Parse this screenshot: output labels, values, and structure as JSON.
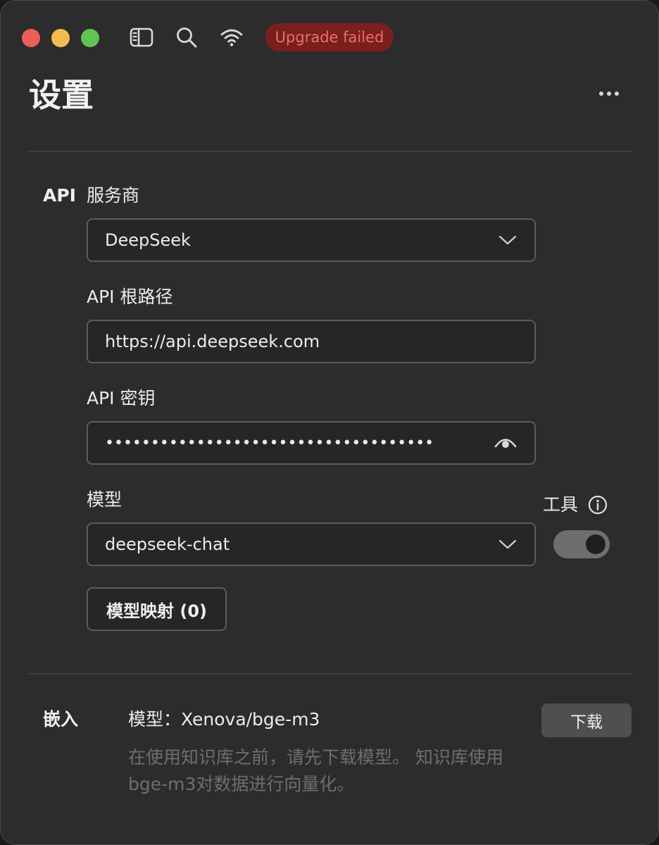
{
  "titlebar": {
    "sidebar_icon": "sidebar-icon",
    "search_icon": "search-icon",
    "wifi_icon": "wifi-icon",
    "badge": "Upgrade failed",
    "badge_color": "#7a1f1d"
  },
  "header": {
    "title": "设置",
    "more_icon": "more-icon"
  },
  "api": {
    "section_label": "API",
    "provider": {
      "label": "服务商",
      "value": "DeepSeek"
    },
    "root_path": {
      "label": "API 根路径",
      "value": "https://api.deepseek.com"
    },
    "key": {
      "label": "API 密钥",
      "value": "••••••••••••••••••••••••••••••••••••"
    },
    "model": {
      "label": "模型",
      "value": "deepseek-chat"
    },
    "tools": {
      "label": "工具",
      "enabled": true
    },
    "mapping_button": "模型映射 (0)"
  },
  "embedding": {
    "section_label": "嵌入",
    "model_text": "模型：Xenova/bge-m3",
    "download_button": "下载",
    "description": "在使用知识库之前，请先下载模型。 知识库使用bge-m3对数据进行向量化。"
  }
}
